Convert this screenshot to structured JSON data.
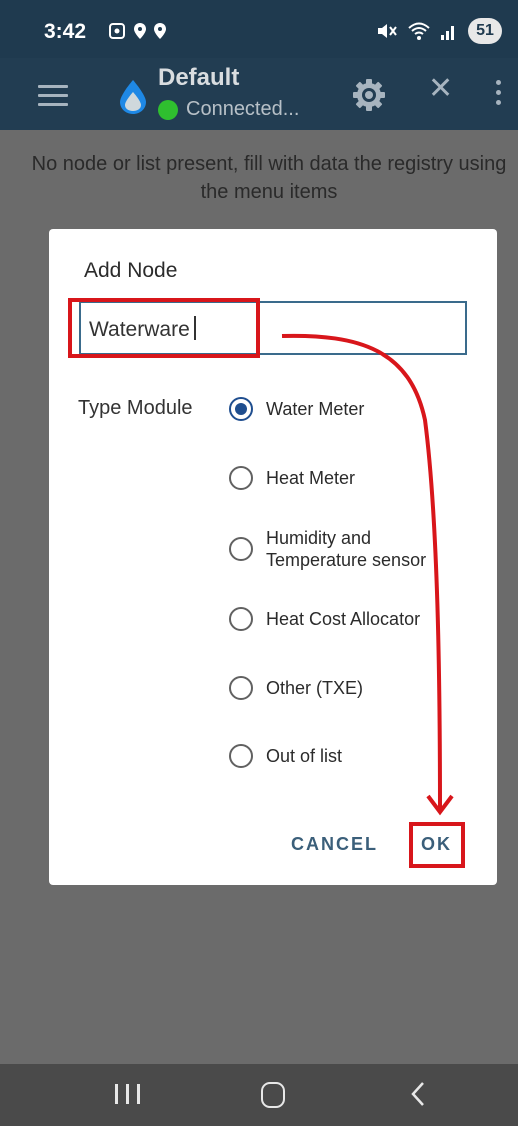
{
  "status_bar": {
    "time": "3:42",
    "battery": "51",
    "left_icons": [
      "screenshot-icon",
      "location-icon",
      "location-icon"
    ],
    "right_icons": [
      "mute-icon",
      "wifi-icon",
      "signal-icon"
    ]
  },
  "app_bar": {
    "title": "Default",
    "status_text": "Connected...",
    "status_color": "#2fbf2f",
    "icons": [
      "menu-icon",
      "water-drop-logo-icon",
      "settings-icon",
      "close-icon",
      "more-vert-icon"
    ]
  },
  "main": {
    "empty_message": "No node or list present, fill with data the registry using the menu items"
  },
  "dialog": {
    "title": "Add Node",
    "input_value": "Waterware",
    "type_label": "Type Module",
    "options": [
      {
        "label": "Water Meter",
        "checked": true
      },
      {
        "label": "Heat Meter",
        "checked": false
      },
      {
        "label": "Humidity and\nTemperature sensor",
        "checked": false
      },
      {
        "label": "Heat Cost Allocator",
        "checked": false
      },
      {
        "label": "Other (TXE)",
        "checked": false
      },
      {
        "label": "Out of list",
        "checked": false
      }
    ],
    "cancel_label": "CANCEL",
    "ok_label": "OK"
  },
  "annotation": {
    "color": "#d8161b"
  },
  "nav_bar": {
    "icons": [
      "recents-icon",
      "home-icon",
      "back-icon"
    ]
  }
}
